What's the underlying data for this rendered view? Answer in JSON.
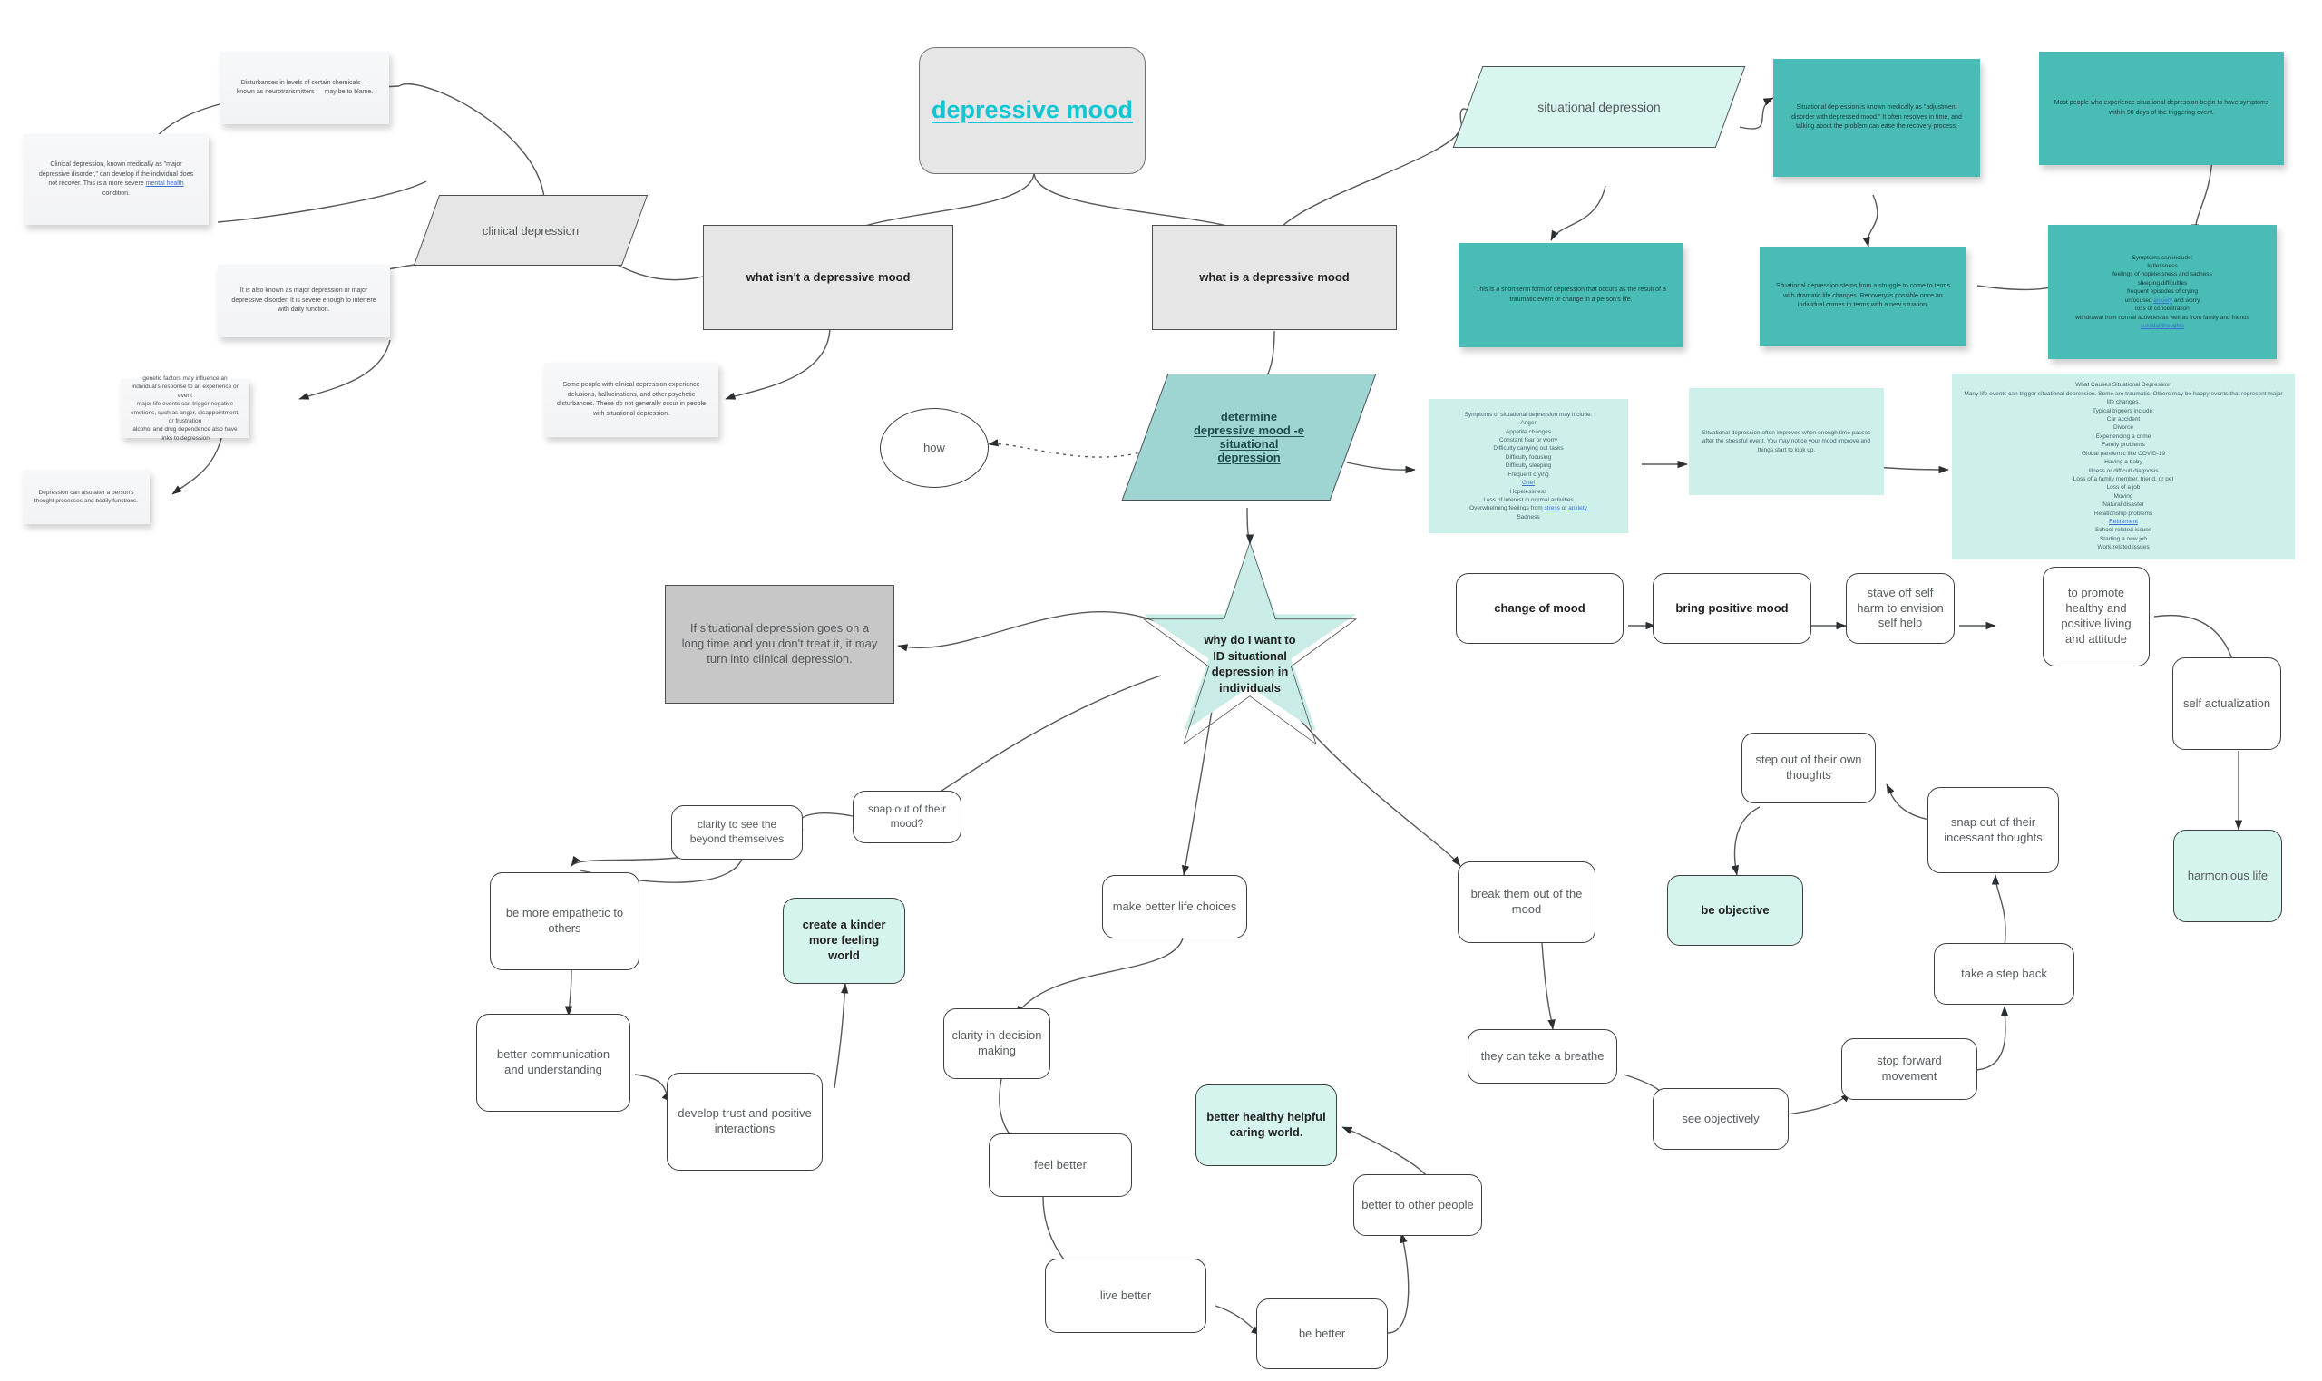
{
  "title": {
    "label": "depressive mood",
    "accent_color": "#0fc7d4"
  },
  "branches": {
    "left_label": "what isn't a depressive mood",
    "right_label": "what is a depressive mood"
  },
  "shapes": {
    "clinical_depression": "clinical depression",
    "situational_depression": "situational depression",
    "determine": "determine depressive mood -e situational depression",
    "determine_lines": [
      "determine ",
      "depressive mood -e",
      "situational",
      "depression"
    ],
    "how": "how",
    "star": "why do I want to ID situational depression in individuals",
    "star_lines": [
      "why do I want to",
      "ID situational",
      "depression in",
      "individuals"
    ]
  },
  "notes_left": [
    {
      "name": "neurotransmitters-note",
      "text": "Disturbances in levels of certain chemicals — known as neurotransmitters — may be to blame."
    },
    {
      "name": "clinical-depression-note",
      "pre": "Clinical depression, known medically as \"major depressive disorder,\" can develop if the individual does not recover. This is a more severe ",
      "link": "mental health",
      "post": " condition."
    },
    {
      "name": "major-depression-note",
      "text": "It is also known as major depression or major depressive disorder. It is severe enough to interfere with daily function."
    },
    {
      "name": "genetic-factors-note",
      "lines": [
        "genetic factors may influence an individual's response to an experience or event",
        "major life events can trigger negative emotions, such as anger, disappointment, or frustration",
        "alcohol and drug dependence also have links to depression"
      ]
    },
    {
      "name": "thought-processes-note",
      "text": "Depression can also alter a person's thought processes and bodily functions."
    },
    {
      "name": "some-people-note",
      "text": "Some people with clinical depression experience delusions, hallucinations, and other psychotic disturbances. These do not generally occur in people with situational depression."
    }
  ],
  "gray_note": {
    "name": "turns-clinical-note",
    "text": "If situational depression goes on a long time and you don't treat it, it may turn into clinical depression."
  },
  "notes_teal": [
    {
      "name": "adjustment-disorder-note",
      "text": "Situational depression is known medically as \"adjustment disorder with depressed mood.\" It often resolves in time, and talking about the problem can ease the recovery process."
    },
    {
      "name": "90-days-note",
      "text": "Most people who experience situational depression begin to have symptoms within 90 days of the triggering event."
    },
    {
      "name": "short-term-note",
      "text": "This is a short-term form of depression that occurs as the result of a traumatic event or change in a person's life."
    },
    {
      "name": "struggle-note",
      "text": "Situational depression stems from a struggle to come to terms with dramatic life changes. Recovery is possible once an individual comes to terms with a new situation."
    },
    {
      "name": "symptoms-can-include-note",
      "heading": "Symptoms can include:",
      "items": [
        "listlessness",
        "feelings of hopelessness and sadness",
        "sleeping difficulties",
        "frequent episodes of crying",
        "unfocused |anxiety| and worry",
        "loss of concentration",
        "withdrawal from normal activities as well as from family and friends",
        "|suicidal thoughts|"
      ]
    }
  ],
  "notes_teal_light": [
    {
      "name": "symptoms-situational-note",
      "heading": "Symptoms of situational depression may include:",
      "items": [
        "Anger",
        "Appetite changes",
        "Constant fear or worry",
        "Difficulty carrying out tasks",
        "Difficulty focusing",
        "Difficulty sleeping",
        "Frequent crying",
        "|Grief|",
        "Hopelessness",
        "Loss of interest in normal activities",
        "Overwhelming feelings from |stress| or |anxiety|",
        "Sadness"
      ]
    },
    {
      "name": "improves-note",
      "text": "Situational depression often improves when enough time passes after the stressful event. You may notice your mood improve and things start to look up."
    },
    {
      "name": "what-causes-note",
      "heading": "What Causes Situational Depression",
      "intro": "Many life events can trigger situational depression. Some are traumatic. Others may be happy events that represent major life changes.",
      "subheading": "Typical triggers include:",
      "items": [
        "Car accident",
        "Divorce",
        "Experiencing a crime",
        "Family problems",
        "Global pandemic like COVID-19",
        "Having a baby",
        "Illness or difficult diagnosis",
        "Loss of a family member, friend, or pet",
        "Loss of a job",
        "Moving",
        "Natural disaster",
        "Relationship problems",
        "|Retirement|",
        "School-related issues",
        "Starting a new job",
        "Work-related issues"
      ]
    }
  ],
  "nodes": {
    "snap_out_of_mood": "snap out of their mood?",
    "clarity_beyond": "clarity to see the beyond themselves",
    "be_more_empathetic": "be more empathetic to others",
    "better_communication": "better communication and understanding",
    "develop_trust": "develop trust and positive interactions",
    "create_kinder_world": "create a kinder more feeling world",
    "make_better_life_choices": "make better life choices",
    "clarity_decision": "clarity in decision making",
    "feel_better": "feel better",
    "live_better": "live better",
    "be_better": "be better",
    "better_to_other_people": "better to other people",
    "better_healthy_world": "better healthy helpful caring world.",
    "break_them_out": "break them out of the mood",
    "take_a_breathe": "they can take a breathe",
    "see_objectively": "see objectively",
    "stop_forward_movement": "stop forward movement",
    "take_a_step_back": "take a step back",
    "snap_incessant": "snap out of their incessant thoughts",
    "step_out_thoughts": "step out of their own thoughts",
    "be_objective": "be objective",
    "change_of_mood": "change of mood",
    "bring_positive_mood": "bring positive mood",
    "stave_off_self_harm": "stave off self harm to envision self help",
    "promote_healthy": "to promote healthy and positive living and attitude",
    "self_actualization": "self actualization",
    "harmonious_life": "harmonious life"
  },
  "colors": {
    "teal_note": "#49bdb5",
    "teal_light": "#cdf0ea",
    "teal_soft": "#d5f4ee",
    "gray_box": "#e6e6e6",
    "gray_dark_box": "#c7c7c7",
    "star_fill": "#c9ece6",
    "accent": "#0fc7d4",
    "link": "#3b6fd4"
  }
}
